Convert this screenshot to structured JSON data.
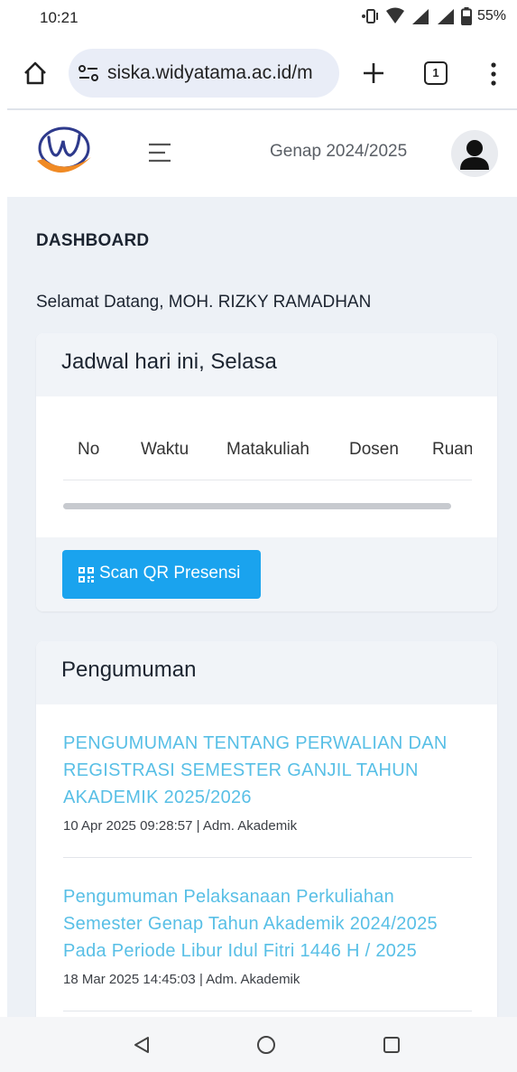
{
  "status_bar": {
    "time": "10:21",
    "battery": "55%"
  },
  "browser": {
    "url": "siska.widyatama.ac.id/m",
    "tab_count": "1"
  },
  "header": {
    "semester": "Genap 2024/2025",
    "accent_color": "#1aa3ee"
  },
  "page": {
    "title": "DASHBOARD",
    "welcome": "Selamat Datang, MOH. RIZKY RAMADHAN"
  },
  "schedule": {
    "title": "Jadwal hari ini, Selasa",
    "columns": [
      "No",
      "Waktu",
      "Matakuliah",
      "Dosen",
      "Ruang"
    ],
    "scan_button": "Scan QR Presensi"
  },
  "announcements": {
    "title": "Pengumuman",
    "items": [
      {
        "title": "PENGUMUMAN TENTANG PERWALIAN DAN REGISTRASI SEMESTER GANJIL TAHUN AKADEMIK 2025/2026",
        "meta": "10 Apr 2025 09:28:57 | Adm. Akademik"
      },
      {
        "title": "Pengumuman Pelaksanaan Perkuliahan Semester Genap Tahun Akademik 2024/2025 Pada Periode Libur Idul Fitri 1446 H / 2025",
        "meta": "18 Mar 2025 14:45:03 | Adm. Akademik"
      }
    ]
  }
}
